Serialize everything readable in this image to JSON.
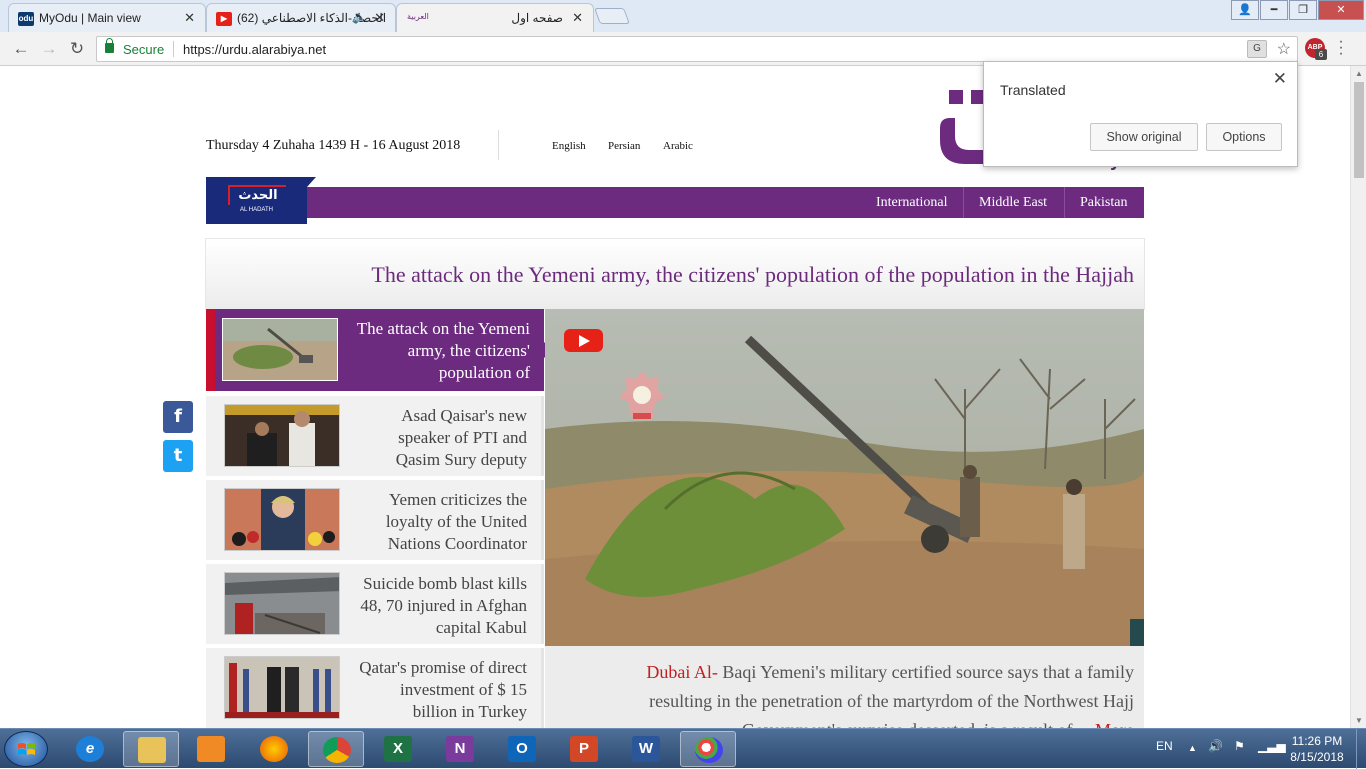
{
  "browser": {
    "tabs": [
      {
        "title": "MyOdu | Main view",
        "favicon": "odu-icon"
      },
      {
        "title": "(62) الحصاد-الذكاء الاصطناعي",
        "favicon": "youtube-icon"
      },
      {
        "title": "صفحه اول",
        "favicon": "alarabiya-icon",
        "favicon_text": "العربية"
      }
    ],
    "secure_label": "Secure",
    "url": "https://urdu.alarabiya.net",
    "extension_label": "ABP",
    "extension_badge": "6"
  },
  "translate_bubble": {
    "title": "Translated",
    "show_original": "Show original",
    "options": "Options"
  },
  "page": {
    "date": "Thursday 4 Zuhaha 1439 H - 16 August 2018",
    "languages": [
      "English",
      "Persian",
      "Arabic"
    ],
    "logo_text": "Al Arabiya",
    "hadath_ar": "الحدث",
    "hadath_en": "AL HADATH",
    "nav": [
      "International",
      "Middle East",
      "Pakistan"
    ],
    "headline": "The attack on the Yemeni army, the citizens' population of the population in the Hajjah",
    "stories": [
      "The attack on the Yemeni army, the citizens' population of",
      "Asad Qaisar's new speaker of PTI and Qasim Sury deputy",
      "Yemen criticizes the loyalty of the United Nations Coordinator",
      "Suicide bomb blast kills 48, 70 injured in Afghan capital Kabul",
      "Qatar's promise of direct investment of $ 15 billion in Turkey"
    ],
    "caption": {
      "place": "Dubai Al-",
      "text": " Baqi Yemeni's military certified source says that a family resulting in the penetration of the martyrdom of the Northwest Hajj Government's surprise desserted, is a result of ... ",
      "more": "More"
    },
    "social": [
      "f",
      "t"
    ]
  },
  "taskbar": {
    "apps": [
      "file-explorer",
      "internet-explorer",
      "media-player",
      "firefox",
      "chrome",
      "excel",
      "onenote",
      "outlook",
      "powerpoint",
      "word",
      "paint"
    ],
    "app_letters": [
      "",
      "e",
      "",
      "",
      "",
      "X",
      "N",
      "O",
      "P",
      "W",
      ""
    ],
    "language": "EN",
    "time": "11:26 PM",
    "date": "8/15/2018"
  },
  "colors": {
    "brand_purple": "#6d2b80",
    "hadath_blue": "#1a2a7a",
    "accent_red": "#c8102e",
    "chrome_secure": "#188038"
  }
}
